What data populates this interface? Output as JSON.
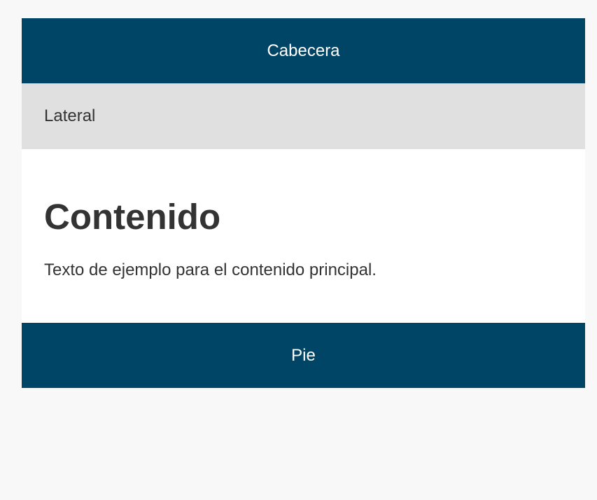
{
  "header": {
    "title": "Cabecera"
  },
  "sidebar": {
    "label": "Lateral"
  },
  "main": {
    "heading": "Contenido",
    "text": "Texto de ejemplo para el contenido principal."
  },
  "footer": {
    "label": "Pie"
  },
  "colors": {
    "primary": "#004466",
    "sidebar_bg": "#e0e0e0",
    "page_bg": "#f8f8f8",
    "text": "#333333"
  }
}
